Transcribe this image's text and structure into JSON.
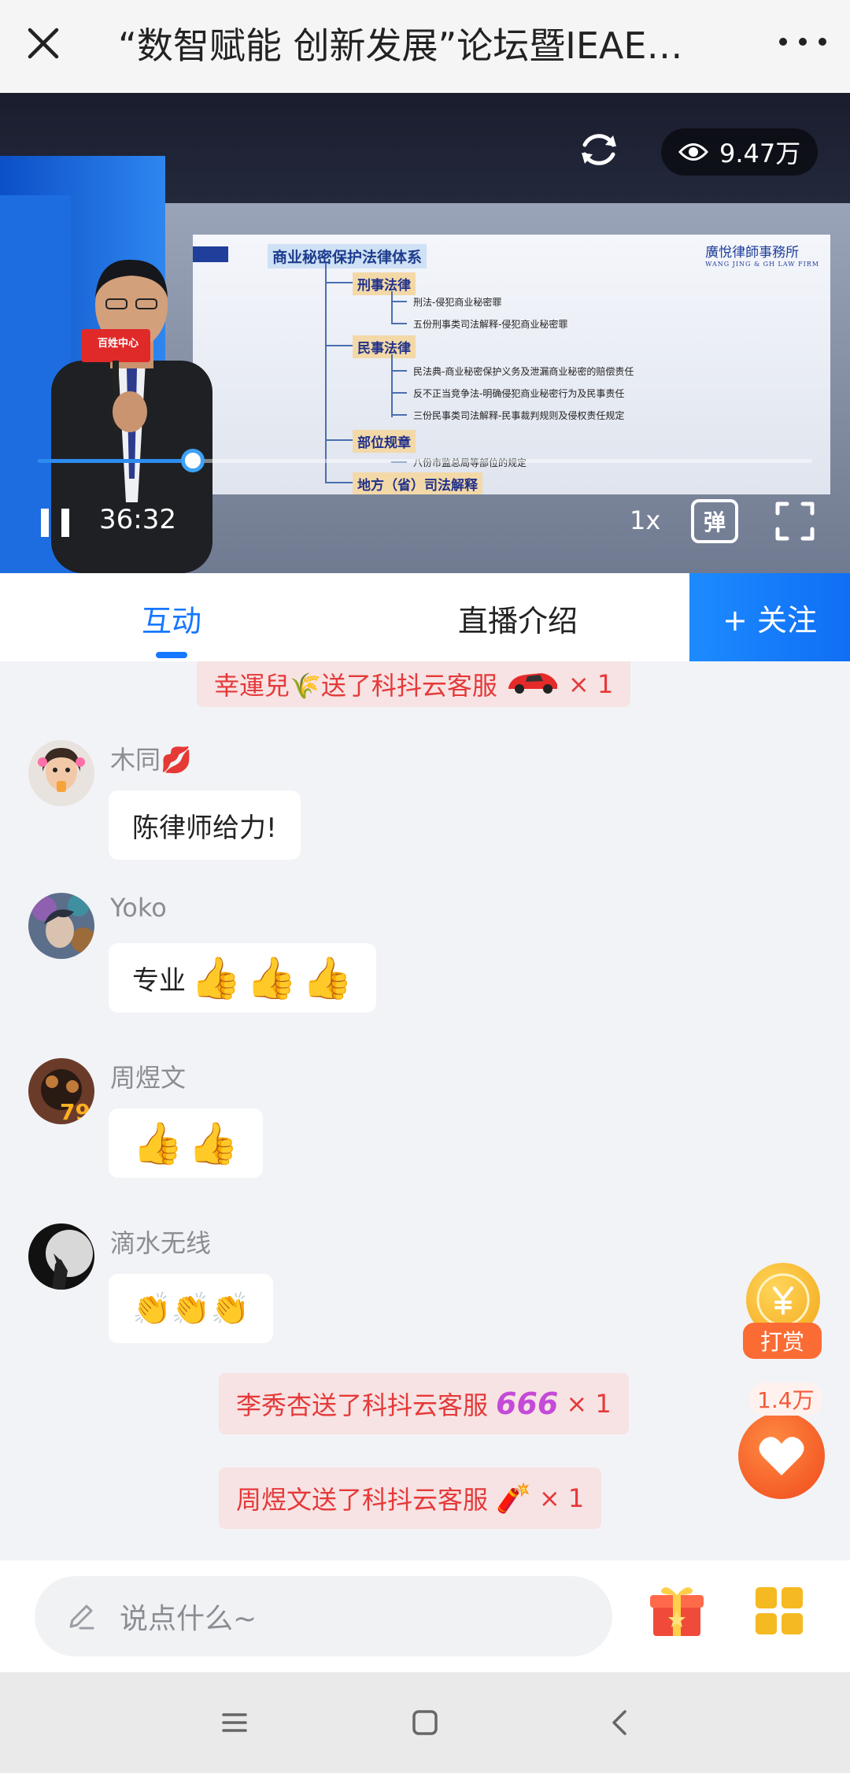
{
  "header": {
    "title": "“数智赋能 创新发展”论坛暨IEAE广…"
  },
  "video": {
    "view_count": "9.47万",
    "current_time": "36:32",
    "speed": "1x",
    "danmu_label": "弹",
    "progress_fraction": 0.2,
    "mic_flag_text": "百姓中心",
    "slide": {
      "title": "商业秘密保护法律体系",
      "firm_name": "廣悅律師事務所",
      "firm_name_en": "WANG JING & GH LAW FIRM",
      "nodes": [
        "刑事法律",
        "民事法律",
        "部位规章",
        "地方（省）司法解释"
      ],
      "leaves": [
        "刑法-侵犯商业秘密罪",
        "五份刑事类司法解释-侵犯商业秘密罪",
        "民法典-商业秘密保护义务及泄漏商业秘密的赔偿责任",
        "反不正当竞争法-明确侵犯商业秘密行为及民事责任",
        "三份民事类司法解释-民事裁判规则及侵权责任规定",
        "八份市监总局等部位的规定"
      ]
    }
  },
  "tabs": {
    "interact": "互动",
    "intro": "直播介绍",
    "follow": "+ 关注"
  },
  "chat": {
    "gift_top": {
      "text": "幸運兒🌾送了科抖云客服",
      "count": "× 1"
    },
    "messages": [
      {
        "user": "木同💋",
        "text": "陈律师给力!"
      },
      {
        "user": "Yoko",
        "text": "专业"
      },
      {
        "user": "周煜文",
        "text": ""
      },
      {
        "user": "滴水无线",
        "text": ""
      }
    ],
    "gifts": [
      {
        "text": "李秀杏送了科抖云客服",
        "count": "× 1",
        "icon": "666"
      },
      {
        "text": "周煜文送了科抖云客服",
        "count": "× 1",
        "icon": "🧨"
      }
    ]
  },
  "side": {
    "reward_label": "打赏",
    "likes_count": "1.4万"
  },
  "input": {
    "placeholder": "说点什么~"
  },
  "colors": {
    "accent": "#1677ff",
    "gift_text": "#e5393a",
    "reward": "#fa6c34"
  }
}
